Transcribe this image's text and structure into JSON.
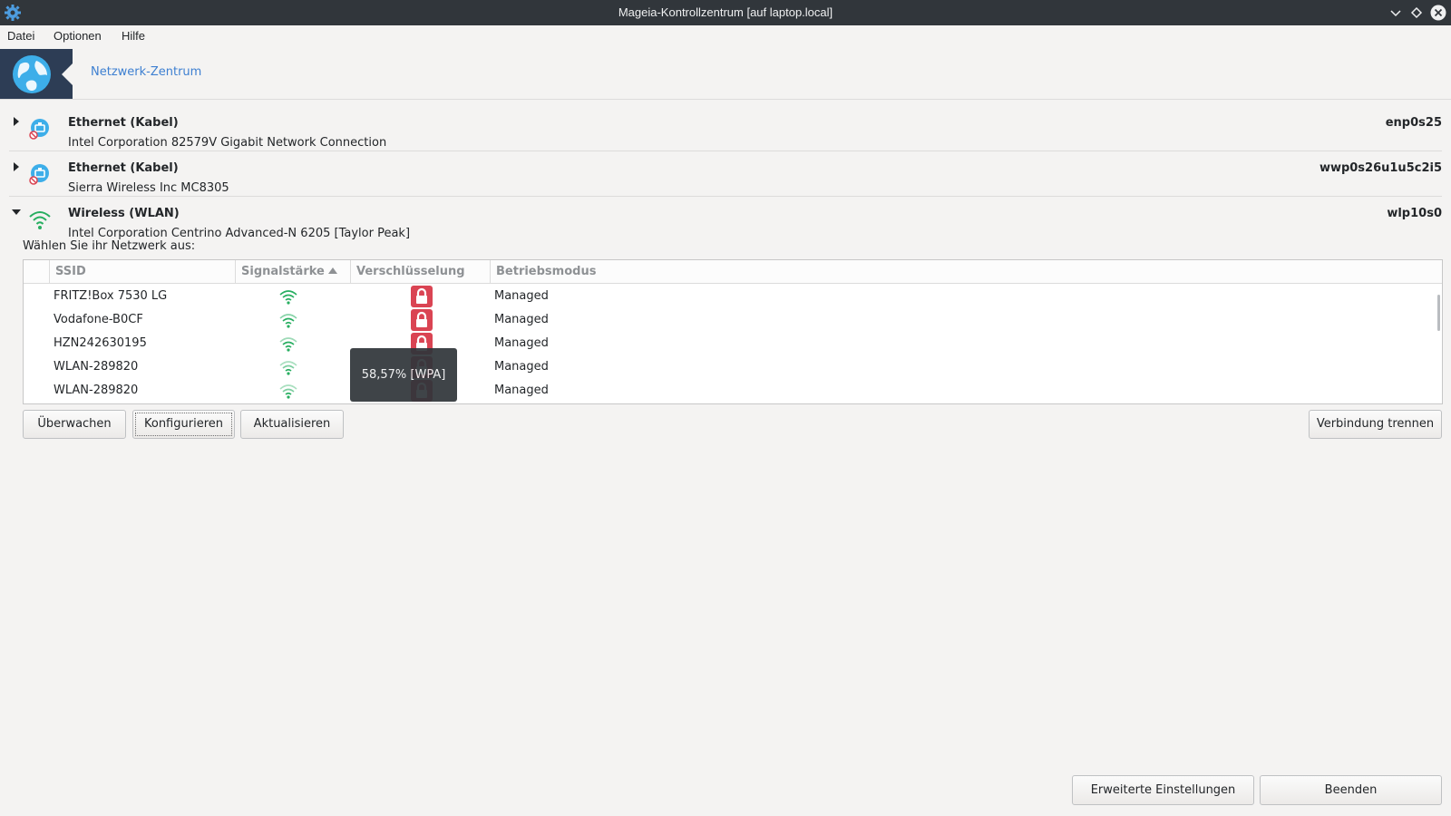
{
  "window": {
    "title": "Mageia-Kontrollzentrum [auf laptop.local]"
  },
  "menu": [
    "Datei",
    "Optionen",
    "Hilfe"
  ],
  "banner": {
    "section": "Netzwerk-Zentrum"
  },
  "devices": [
    {
      "name": "Ethernet (Kabel)",
      "description": "Intel Corporation 82579V Gigabit Network Connection",
      "interface": "enp0s25",
      "icon": "ethernet-disconnected-icon",
      "expanded": false
    },
    {
      "name": "Ethernet (Kabel)",
      "description": "Sierra Wireless Inc MC8305",
      "interface": "wwp0s26u1u5c2i5",
      "icon": "ethernet-disconnected-icon",
      "expanded": false
    },
    {
      "name": "Wireless (WLAN)",
      "description": "Intel Corporation Centrino Advanced-N 6205 [Taylor Peak]",
      "interface": "wlp10s0",
      "icon": "wifi-icon",
      "expanded": true
    }
  ],
  "wireless": {
    "prompt": "Wählen Sie ihr Netzwerk aus:",
    "columns": [
      "SSID",
      "Signalstärke",
      "Verschlüsselung",
      "Betriebsmodus"
    ],
    "sorted_column": "Signalstärke",
    "networks": [
      {
        "ssid": "FRITZ!Box 7530 LG",
        "encrypted": true,
        "mode": "Managed"
      },
      {
        "ssid": "Vodafone-B0CF",
        "encrypted": true,
        "mode": "Managed"
      },
      {
        "ssid": "HZN242630195",
        "encrypted": true,
        "mode": "Managed"
      },
      {
        "ssid": "WLAN-289820",
        "encrypted": true,
        "mode": "Managed"
      },
      {
        "ssid": "WLAN-289820",
        "encrypted": true,
        "mode": "Managed"
      }
    ],
    "tooltip": "58,57% [WPA]"
  },
  "actions": {
    "monitor": "Überwachen",
    "configure": "Konfigurieren",
    "refresh": "Aktualisieren",
    "disconnect": "Verbindung trennen"
  },
  "footer": {
    "advanced": "Erweiterte Einstellungen",
    "quit": "Beenden"
  },
  "colors": {
    "titlebar": "#31363b",
    "accent": "#3d7fd1",
    "banner_logo_bg": "#2d3d55",
    "signal_green": "#27ae60",
    "lock_red": "#da4453"
  }
}
